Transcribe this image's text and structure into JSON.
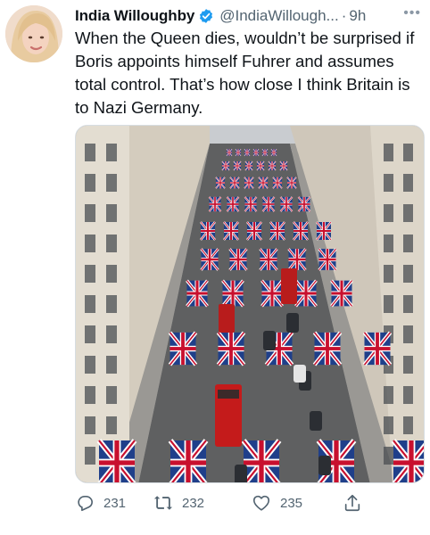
{
  "tweet": {
    "author_name": "India Willoughby",
    "author_handle": "@IndiaWillough...",
    "separator": "·",
    "time": "9h",
    "more_label": "•••",
    "text": "When the Queen dies, wouldn’t be surprised if Boris appoints himself Fuhrer and assumes total control. That’s how close I think Britain is to Nazi Germany.",
    "icons": {
      "verified": "verified-badge-icon",
      "reply": "reply-icon",
      "retweet": "retweet-icon",
      "like": "heart-icon",
      "share": "share-icon"
    },
    "stats": {
      "replies": "231",
      "retweets": "232",
      "likes": "235"
    },
    "colors": {
      "verified_blue": "#1d9bf0",
      "text_primary": "#0f1419",
      "text_secondary": "#536471"
    }
  }
}
